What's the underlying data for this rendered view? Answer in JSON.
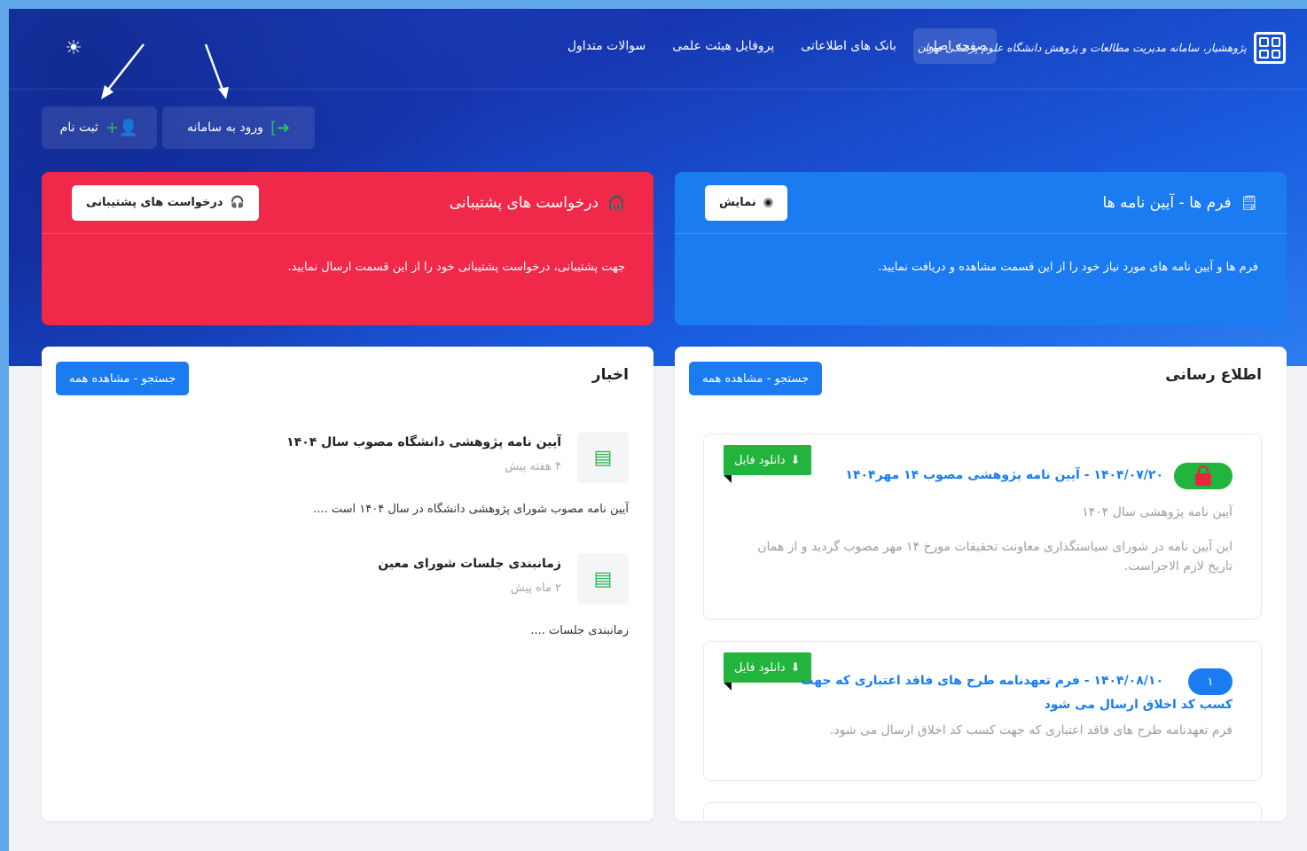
{
  "brand": {
    "name": "پژوهشیار، سامانه مدیریت مطالعات و پژوهش دانشگاه علوم پزشکی تهران"
  },
  "nav": {
    "items": [
      "صفحه اصلی",
      "بانک های اطلاعاتی",
      "پروفایل هیئت علمی",
      "سوالات متداول"
    ],
    "active_index": 0
  },
  "auth": {
    "login_label": "ورود به سامانه",
    "register_label": "ثبت نام"
  },
  "forms_card": {
    "title": "فرم ها - آیین نامه ها",
    "button": "نمایش",
    "body": "فرم ها و آیین نامه های مورد نیاز خود را از این قسمت مشاهده و دریافت نمایید.",
    "color": "#1a7cf0"
  },
  "support_card": {
    "title": "درخواست های پشتیبانی",
    "button": "درخواست های پشتیبانی",
    "body": "جهت پشتیبانی، درخواست پشتیبانی خود را از این قسمت ارسال نمایید.",
    "color": "#f0284a"
  },
  "announcements": {
    "title": "اطلاع رسانی",
    "search_button": "جستجو - مشاهده همه",
    "items": [
      {
        "badge": "lock",
        "download": "دانلود فایل",
        "title": "۱۴۰۴/۰۷/۲۰ - آیین نامه پژوهشی مصوب ۱۴ مهر۱۴۰۴",
        "subtitle": "آیین نامه پژوهشی سال ۱۴۰۴",
        "body": "این آیین نامه در شورای سیاستگذاری معاونت تحقیقات مورخ ۱۴ مهر مصوب گردید و از همان تاریخ لازم الاجراست."
      },
      {
        "badge": "۱",
        "download": "دانلود فایل",
        "title_line1": "۱۴۰۴/۰۸/۱۰ - فرم تعهدنامه طرح های فاقد اعتباری که جهت",
        "title_line2": "کسب کد اخلاق ارسال می شود",
        "body": "فرم تعهدنامه طرح های فاقد اعتباری که جهت کسب کد اخلاق ارسال می شود."
      }
    ]
  },
  "news": {
    "title": "اخبار",
    "search_button": "جستجو - مشاهده همه",
    "items": [
      {
        "title": "آیین نامه پژوهشی دانشگاه مصوب سال ۱۴۰۴",
        "time": "۴ هفته پیش",
        "desc": "آیین نامه مصوب شورای پژوهشی دانشگاه در سال ۱۴۰۴ است ...."
      },
      {
        "title": "زمانبندی جلسات شورای معین",
        "time": "۲ ماه پیش",
        "desc": "زمانبندی جلسات ...."
      }
    ]
  }
}
